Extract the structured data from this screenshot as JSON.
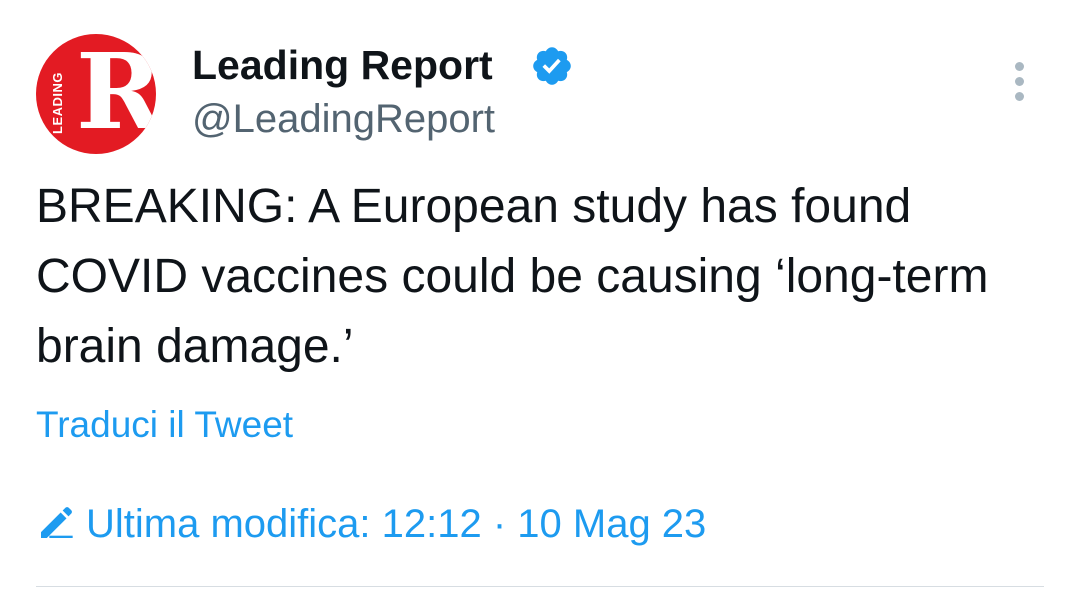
{
  "tweet": {
    "avatar_letter": "R",
    "avatar_side_text": "LEADING",
    "display_name": "Leading Report",
    "verified_icon": "verified-badge-icon",
    "handle": "@LeadingReport",
    "more_icon": "more-vertical-icon",
    "text": "BREAKING: A European study has found COVID vaccines could be causing ‘long-term brain damage.’",
    "translate_label": "Traduci il Tweet",
    "edited_icon": "pencil-icon",
    "edited_label": "Ultima modifica: 12:12 · 10 Mag 23"
  },
  "colors": {
    "accent": "#1d9bf0",
    "avatar_red": "#e31b23",
    "text": "#0f1419",
    "secondary": "#536471"
  }
}
